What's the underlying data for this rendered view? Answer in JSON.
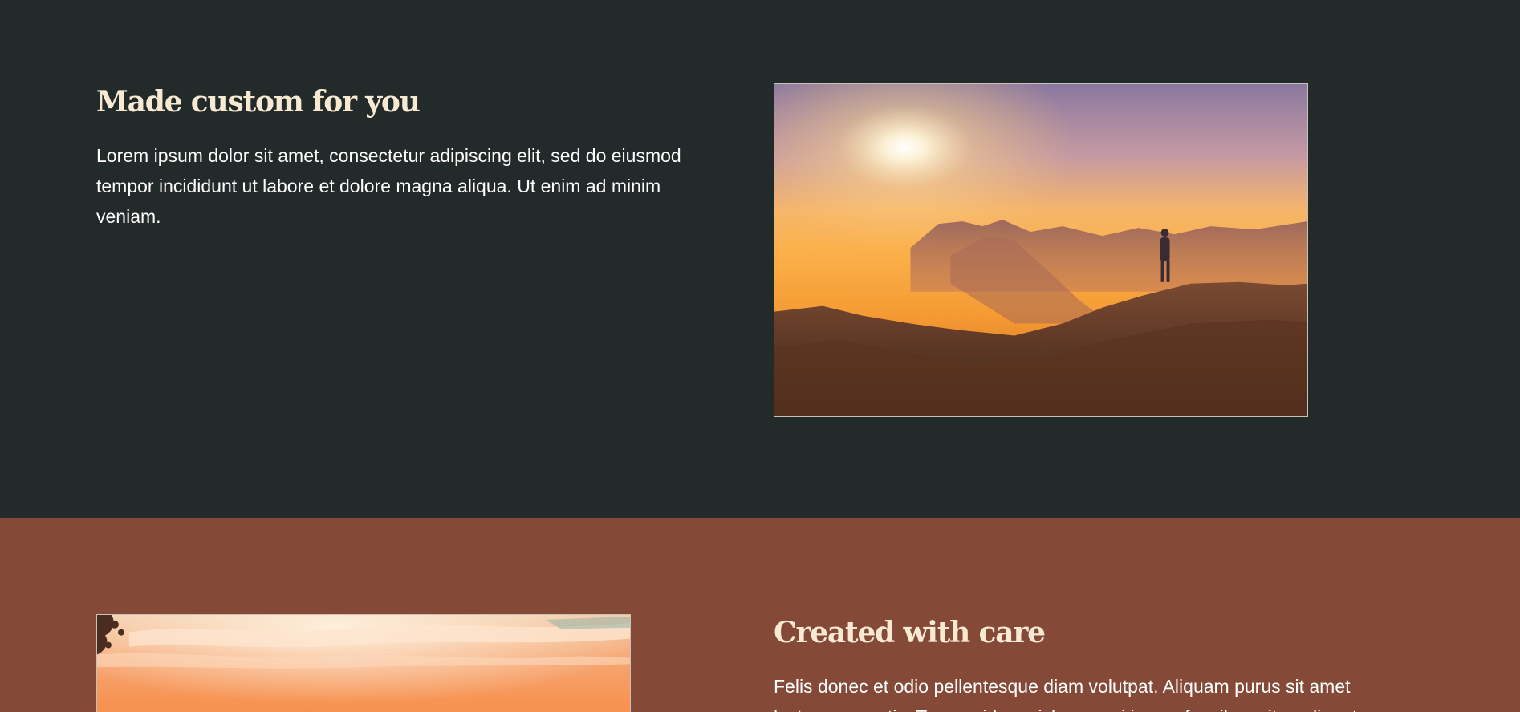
{
  "sections": [
    {
      "heading": "Made custom for you",
      "body": "Lorem ipsum dolor sit amet, consectetur adipiscing elit, sed do eiusmod tempor incididunt ut labore et dolore magna aliqua. Ut enim ad minim veniam.",
      "image": "mountain-sunrise-hiker-photo",
      "background": "#232a2a"
    },
    {
      "heading": "Created with care",
      "body": "Felis donec et odio pellentesque diam volutpat. Aliquam purus sit amet luctus venenatis. Tempor id eu nisl nunc mi ipsum faucibus vitae aliquet.",
      "image": "sunset-clouds-photo",
      "background": "#844a37"
    }
  ],
  "colors": {
    "heading": "#f7e9d2",
    "text": "#ffffff",
    "dark_section": "#232a2a",
    "rust_section": "#844a37"
  }
}
